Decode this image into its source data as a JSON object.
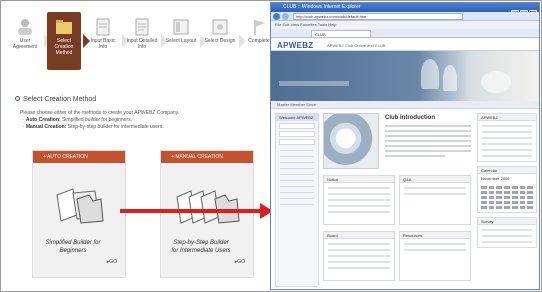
{
  "steps": [
    {
      "label": "User Agreement",
      "icon": "user-icon"
    },
    {
      "label": "Select Creation Method",
      "icon": "folder-icon",
      "active": true
    },
    {
      "label": "Input Basic Info",
      "icon": "document-icon"
    },
    {
      "label": "Input Detailed Info",
      "icon": "document-icon"
    },
    {
      "label": "Select Layout",
      "icon": "layout-icon"
    },
    {
      "label": "Select Design",
      "icon": "design-icon"
    },
    {
      "label": "Complete",
      "icon": "flag-icon"
    }
  ],
  "method": {
    "heading": "Select Creation Method",
    "instruction": "Please choose either of the methods to create your APWEBZ Company.",
    "auto_term": "Auto Creation:",
    "auto_desc": " Simplified builder for beginners.",
    "manual_term": "Manual Creation:",
    "manual_desc": " Step-by-step builder for intermediate users."
  },
  "cards": {
    "auto": {
      "title": "AUTO CREATION",
      "caption": "Simplified Builder for Beginners",
      "go": "GO"
    },
    "manual": {
      "title": "MANUAL CREATION",
      "caption": "Step-by-Step Builder for Intermediate Users",
      "go": "GO"
    }
  },
  "browser": {
    "window_title": "CLUB :: Windows Internet Explorer",
    "url": "http://club.apwebz.com/club/default.htm",
    "menu": "File  Edit  View  Favorites  Tools  Help",
    "tab": "CLUB",
    "site": {
      "logo": "APWEBZ",
      "tagline": "APWEBZ Club Online and CLUB",
      "subnav": "Master  Member  Since",
      "login_title": "Welcome APWEBZ",
      "intro_title": "Club Introduction",
      "box1": "Notice",
      "box2": "Q&A",
      "box3": "Board",
      "box4": "Resources",
      "right1": "APWEBZ",
      "right2": "Calendar",
      "right3": "Survey",
      "calendar_month": "November 2006"
    }
  },
  "colors": {
    "active_step": "#7a3b23",
    "card_bar": "#c4532d",
    "arrow": "#e21b1b"
  }
}
